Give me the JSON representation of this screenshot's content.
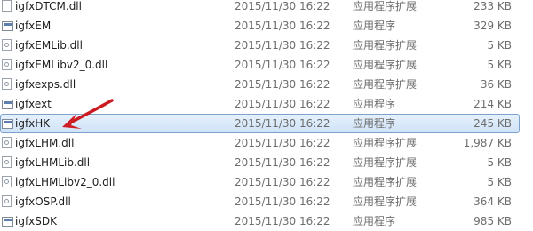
{
  "files": [
    {
      "name": "igfxDTCM.dll",
      "date": "2015/11/30 16:22",
      "type": "应用程序扩展",
      "size": "233 KB",
      "icon": "dll-file-icon"
    },
    {
      "name": "igfxEM",
      "date": "2015/11/30 16:22",
      "type": "应用程序",
      "size": "329 KB",
      "icon": "exe-file-icon"
    },
    {
      "name": "igfxEMLib.dll",
      "date": "2015/11/30 16:22",
      "type": "应用程序扩展",
      "size": "5 KB",
      "icon": "dll-file-icon"
    },
    {
      "name": "igfxEMLibv2_0.dll",
      "date": "2015/11/30 16:22",
      "type": "应用程序扩展",
      "size": "5 KB",
      "icon": "dll-file-icon"
    },
    {
      "name": "igfxexps.dll",
      "date": "2015/11/30 16:22",
      "type": "应用程序扩展",
      "size": "36 KB",
      "icon": "dll-file-icon"
    },
    {
      "name": "igfxext",
      "date": "2015/11/30 16:22",
      "type": "应用程序",
      "size": "214 KB",
      "icon": "exe-file-icon"
    },
    {
      "name": "igfxHK",
      "date": "2015/11/30 16:22",
      "type": "应用程序",
      "size": "245 KB",
      "icon": "exe-file-icon",
      "selected": true
    },
    {
      "name": "igfxLHM.dll",
      "date": "2015/11/30 16:22",
      "type": "应用程序扩展",
      "size": "1,987 KB",
      "icon": "dll-file-icon"
    },
    {
      "name": "igfxLHMLib.dll",
      "date": "2015/11/30 16:22",
      "type": "应用程序扩展",
      "size": "5 KB",
      "icon": "dll-file-icon"
    },
    {
      "name": "igfxLHMLibv2_0.dll",
      "date": "2015/11/30 16:22",
      "type": "应用程序扩展",
      "size": "5 KB",
      "icon": "dll-file-icon"
    },
    {
      "name": "igfxOSP.dll",
      "date": "2015/11/30 16:22",
      "type": "应用程序扩展",
      "size": "364 KB",
      "icon": "dll-file-icon"
    },
    {
      "name": "igfxSDK",
      "date": "2015/11/30 16:22",
      "type": "应用程序",
      "size": "985 KB",
      "icon": "exe-file-icon"
    }
  ],
  "colors": {
    "selection_border": "#7da2ce",
    "selection_fill": "#d9e9f9",
    "annotation_arrow": "#d7262b",
    "secondary_text": "#6d6d6d"
  }
}
